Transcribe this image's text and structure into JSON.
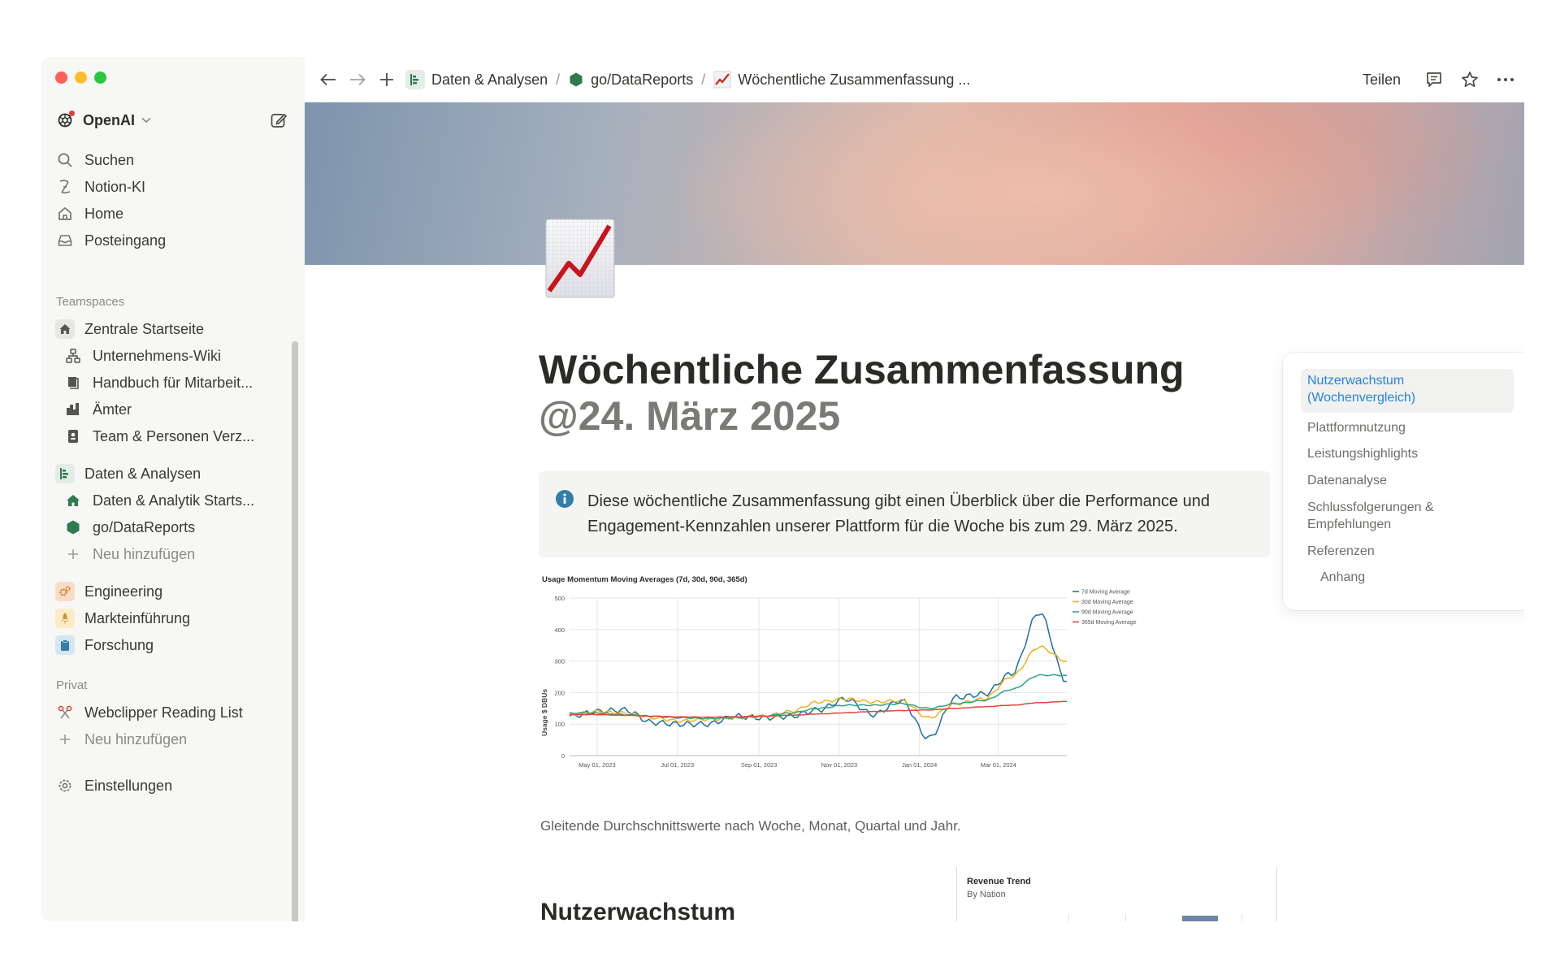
{
  "window": {
    "traffic_lights": [
      "#fe5f57",
      "#febc2e",
      "#28c840"
    ]
  },
  "sidebar": {
    "workspace": {
      "name": "OpenAI",
      "icon": "openai-logo-icon"
    },
    "top_items": [
      {
        "label": "Suchen",
        "icon": "search-icon"
      },
      {
        "label": "Notion-KI",
        "icon": "ai-face-icon"
      },
      {
        "label": "Home",
        "icon": "home-icon"
      },
      {
        "label": "Posteingang",
        "icon": "inbox-icon"
      }
    ],
    "teamspaces_label": "Teamspaces",
    "teamspaces": [
      {
        "label": "Zentrale Startseite",
        "icon": "house-icon"
      },
      {
        "label": "Unternehmens-Wiki",
        "icon": "org-chart-icon",
        "nested": true
      },
      {
        "label": "Handbuch für Mitarbeit...",
        "icon": "book-icon",
        "nested": true
      },
      {
        "label": "Ämter",
        "icon": "buildings-icon",
        "nested": true
      },
      {
        "label": "Team & Personen Verz...",
        "icon": "contact-icon",
        "nested": true
      },
      {
        "label": "Daten & Analysen",
        "icon": "chart-bars-icon"
      },
      {
        "label": "Daten & Analytik Starts...",
        "icon": "house-green-icon",
        "nested": true
      },
      {
        "label": "go/DataReports",
        "icon": "hexagon-icon",
        "nested": true
      },
      {
        "label": "Neu hinzufügen",
        "icon": "plus-icon",
        "nested": true,
        "muted": true
      },
      {
        "label": "Engineering",
        "icon": "gears-icon"
      },
      {
        "label": "Markteinführung",
        "icon": "rocket-icon"
      },
      {
        "label": "Forschung",
        "icon": "clipboard-icon"
      }
    ],
    "private_label": "Privat",
    "private": [
      {
        "label": "Webclipper Reading List",
        "icon": "scissors-icon"
      },
      {
        "label": "Neu hinzufügen",
        "icon": "plus-icon",
        "muted": true
      }
    ],
    "settings_label": "Einstellungen"
  },
  "topbar": {
    "breadcrumbs": [
      {
        "label": "Daten & Analysen",
        "icon": "chart-bars-icon"
      },
      {
        "label": "go/DataReports",
        "icon": "hexagon-icon"
      },
      {
        "label": "Wöchentliche Zusammenfassung ...",
        "icon": "chart-increasing-icon"
      }
    ],
    "separator": "/",
    "share_label": "Teilen"
  },
  "page": {
    "title": "Wöchentliche Zusammenfassung",
    "date_mention": "@24. März 2025",
    "callout": "Diese wöchentliche Zusammenfassung gibt einen Überblick über die Performance und Engagement-Kennzahlen unserer Plattform für die Woche bis zum 29. März 2025.",
    "chart_caption": "Gleitende Durchschnittswerte nach Woche, Monat, Quartal und Jahr.",
    "section_heading": "Nutzerwachstum",
    "revenue_card": {
      "title": "Revenue Trend",
      "subtitle": "By Nation"
    }
  },
  "toc": [
    {
      "label": "Nutzerwachstum (Wochenvergleich)",
      "active": true
    },
    {
      "label": "Plattformnutzung"
    },
    {
      "label": "Leistungshighlights"
    },
    {
      "label": "Datenanalyse"
    },
    {
      "label": "Schlussfolgerungen & Empfehlungen"
    },
    {
      "label": "Referenzen"
    },
    {
      "label": "Anhang",
      "nested": true
    }
  ],
  "chart_data": {
    "type": "line",
    "title": "Usage Momentum Moving Averages (7d, 30d, 90d, 365d)",
    "ylabel": "Usage $ DBUs",
    "ylim": [
      0,
      500
    ],
    "yticks": [
      0,
      100,
      200,
      300,
      400,
      500
    ],
    "xticks": [
      "May 01, 2023",
      "Jul 01, 2023",
      "Sep 01, 2023",
      "Nov 01, 2023",
      "Jan 01, 2024",
      "Mar 01, 2024"
    ],
    "x": [
      "2023-04-10",
      "2023-05-01",
      "2023-05-22",
      "2023-06-12",
      "2023-07-03",
      "2023-07-24",
      "2023-08-14",
      "2023-09-04",
      "2023-09-25",
      "2023-10-16",
      "2023-11-06",
      "2023-11-27",
      "2023-12-18",
      "2024-01-08",
      "2024-01-29",
      "2024-02-19",
      "2024-03-11",
      "2024-04-01",
      "2024-04-22"
    ],
    "legend_position": "top-right",
    "grid": true,
    "series": [
      {
        "name": "7d Moving Average",
        "color": "#1f6f9f",
        "values": [
          125,
          140,
          145,
          105,
          100,
          100,
          125,
          120,
          125,
          145,
          180,
          130,
          175,
          55,
          185,
          195,
          260,
          455,
          235
        ]
      },
      {
        "name": "30d Moving Average",
        "color": "#f2b01e",
        "values": [
          130,
          140,
          135,
          120,
          110,
          115,
          120,
          125,
          140,
          170,
          180,
          170,
          175,
          120,
          165,
          180,
          250,
          345,
          300
        ]
      },
      {
        "name": "90d Moving Average",
        "color": "#2aa38a",
        "values": [
          135,
          135,
          130,
          125,
          120,
          118,
          120,
          125,
          135,
          150,
          160,
          160,
          165,
          150,
          165,
          175,
          210,
          255,
          255
        ]
      },
      {
        "name": "365d Moving Average",
        "color": "#e0483b",
        "values": [
          130,
          130,
          128,
          125,
          123,
          122,
          123,
          125,
          128,
          132,
          136,
          140,
          143,
          145,
          150,
          155,
          160,
          168,
          172
        ]
      }
    ]
  }
}
